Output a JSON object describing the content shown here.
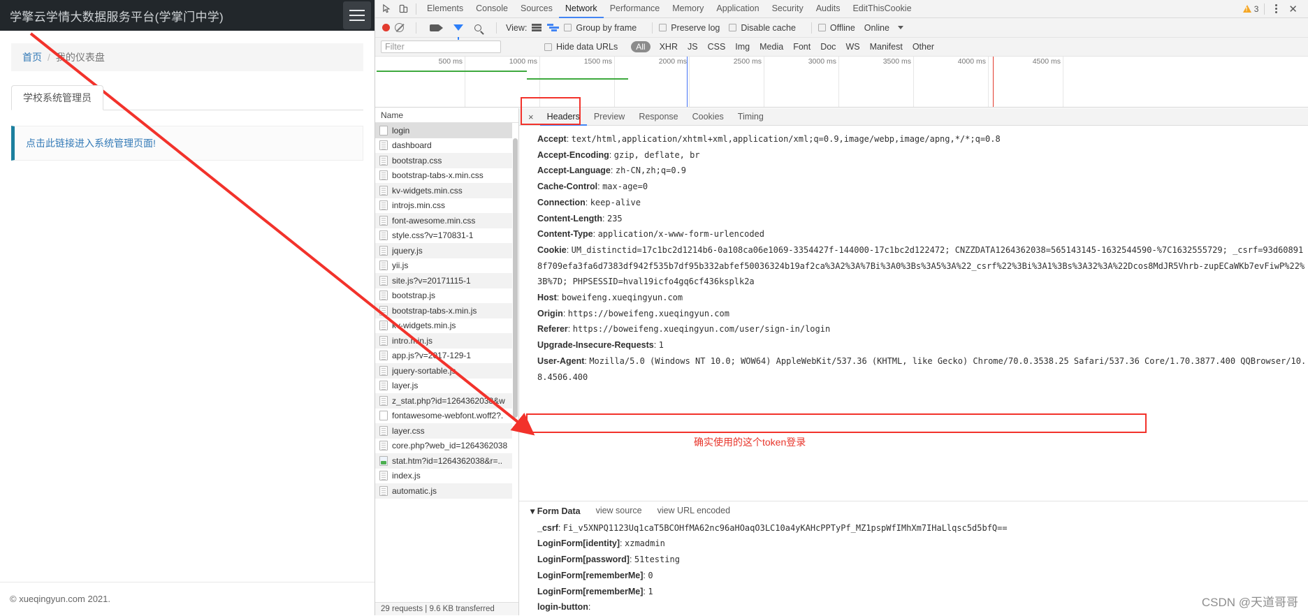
{
  "webpage": {
    "title": "学擎云学情大数据服务平台(学掌门中学)",
    "hamburger": "menu-icon",
    "breadcrumb": {
      "home": "首页",
      "separator": "/",
      "current": "我的仪表盘"
    },
    "tab": "学校系统管理员",
    "alert_link": "点击此链接进入系统管理页面!",
    "footer": "© xueqingyun.com 2021."
  },
  "devtools": {
    "tabs": [
      "Elements",
      "Console",
      "Sources",
      "Network",
      "Performance",
      "Memory",
      "Application",
      "Security",
      "Audits",
      "EditThisCookie"
    ],
    "active_tab": "Network",
    "warning_count": "3",
    "icons": {
      "inspect": "inspect-icon",
      "device": "device-toolbar-icon",
      "menu": "kebab-menu-icon",
      "close": "close-icon"
    },
    "toolbar": {
      "record": "record-icon",
      "clear": "clear-icon",
      "capture_screenshots": "camera-icon",
      "filter": "funnel-icon",
      "search": "search-icon",
      "view_label": "View:",
      "group_by_frame": "Group by frame",
      "preserve_log": "Preserve log",
      "disable_cache": "Disable cache",
      "offline": "Offline",
      "throttling": "Online"
    },
    "filterbar": {
      "filter_placeholder": "Filter",
      "hide_data_urls": "Hide data URLs",
      "types": [
        "All",
        "XHR",
        "JS",
        "CSS",
        "Img",
        "Media",
        "Font",
        "Doc",
        "WS",
        "Manifest",
        "Other"
      ],
      "active_type": "All"
    },
    "overview_ticks": [
      "500 ms",
      "1000 ms",
      "1500 ms",
      "2000 ms",
      "2500 ms",
      "3000 ms",
      "3500 ms",
      "4000 ms",
      "4500 ms"
    ],
    "name_column_header": "Name",
    "requests": [
      {
        "name": "login",
        "icon": "blank"
      },
      {
        "name": "dashboard",
        "icon": "doc"
      },
      {
        "name": "bootstrap.css",
        "icon": "doc"
      },
      {
        "name": "bootstrap-tabs-x.min.css",
        "icon": "doc"
      },
      {
        "name": "kv-widgets.min.css",
        "icon": "doc"
      },
      {
        "name": "introjs.min.css",
        "icon": "doc"
      },
      {
        "name": "font-awesome.min.css",
        "icon": "doc"
      },
      {
        "name": "style.css?v=170831-1",
        "icon": "doc"
      },
      {
        "name": "jquery.js",
        "icon": "doc"
      },
      {
        "name": "yii.js",
        "icon": "doc"
      },
      {
        "name": "site.js?v=20171115-1",
        "icon": "doc"
      },
      {
        "name": "bootstrap.js",
        "icon": "doc"
      },
      {
        "name": "bootstrap-tabs-x.min.js",
        "icon": "doc"
      },
      {
        "name": "kv-widgets.min.js",
        "icon": "doc"
      },
      {
        "name": "intro.min.js",
        "icon": "doc"
      },
      {
        "name": "app.js?v=2017-129-1",
        "icon": "doc"
      },
      {
        "name": "jquery-sortable.js",
        "icon": "doc"
      },
      {
        "name": "layer.js",
        "icon": "doc"
      },
      {
        "name": "z_stat.php?id=1264362038&w",
        "icon": "doc"
      },
      {
        "name": "fontawesome-webfont.woff2?.",
        "icon": "blank"
      },
      {
        "name": "layer.css",
        "icon": "doc"
      },
      {
        "name": "core.php?web_id=1264362038",
        "icon": "doc"
      },
      {
        "name": "stat.htm?id=1264362038&r=..",
        "icon": "img"
      },
      {
        "name": "index.js",
        "icon": "doc"
      },
      {
        "name": "automatic.js",
        "icon": "doc"
      }
    ],
    "requests_summary": "29 requests | 9.6 KB transferred",
    "detail_tabs": [
      "Headers",
      "Preview",
      "Response",
      "Cookies",
      "Timing"
    ],
    "detail_active_tab": "Headers",
    "detail_close": "×",
    "headers": [
      {
        "key": "Accept",
        "value": "text/html,application/xhtml+xml,application/xml;q=0.9,image/webp,image/apng,*/*;q=0.8"
      },
      {
        "key": "Accept-Encoding",
        "value": "gzip, deflate, br"
      },
      {
        "key": "Accept-Language",
        "value": "zh-CN,zh;q=0.9"
      },
      {
        "key": "Cache-Control",
        "value": "max-age=0"
      },
      {
        "key": "Connection",
        "value": "keep-alive"
      },
      {
        "key": "Content-Length",
        "value": "235"
      },
      {
        "key": "Content-Type",
        "value": "application/x-www-form-urlencoded"
      },
      {
        "key": "Cookie",
        "value": "UM_distinctid=17c1bc2d1214b6-0a108ca06e1069-3354427f-144000-17c1bc2d122472; CNZZDATA1264362038=565143145-1632544590-%7C1632555729; _csrf=93d608918f709efa3fa6d7383df942f535b7df95b332abfef50036324b19af2ca%3A2%3A%7Bi%3A0%3Bs%3A5%3A%22_csrf%22%3Bi%3A1%3Bs%3A32%3A%22Dcos8MdJR5Vhrb-zupECaWKb7evFiwP%22%3B%7D; PHPSESSID=hval19icfo4gq6cf436ksplk2a"
      },
      {
        "key": "Host",
        "value": "boweifeng.xueqingyun.com"
      },
      {
        "key": "Origin",
        "value": "https://boweifeng.xueqingyun.com"
      },
      {
        "key": "Referer",
        "value": "https://boweifeng.xueqingyun.com/user/sign-in/login"
      },
      {
        "key": "Upgrade-Insecure-Requests",
        "value": "1"
      },
      {
        "key": "User-Agent",
        "value": "Mozilla/5.0 (Windows NT 10.0; WOW64) AppleWebKit/537.36 (KHTML, like Gecko) Chrome/70.0.3538.25 Safari/537.36 Core/1.70.3877.400 QQBrowser/10.8.4506.400"
      }
    ],
    "form_data": {
      "title": "Form Data",
      "view_source": "view source",
      "view_url_encoded": "view URL encoded",
      "rows": [
        {
          "key": "_csrf",
          "value": "Fi_v5XNPQ1123Uq1caT5BCOHfMA62nc96aHOaqO3LC10a4yKAHcPPTyPf_MZ1pspWfIMhXm7IHaLlqsc5d5bfQ=="
        },
        {
          "key": "LoginForm[identity]",
          "value": "xzmadmin"
        },
        {
          "key": "LoginForm[password]",
          "value": "51testing"
        },
        {
          "key": "LoginForm[rememberMe]",
          "value": "0"
        },
        {
          "key": "LoginForm[rememberMe]",
          "value": "1"
        },
        {
          "key": "login-button",
          "value": ""
        }
      ]
    },
    "annotation": "确实使用的这个token登录"
  },
  "watermark": "CSDN @天道哥哥"
}
